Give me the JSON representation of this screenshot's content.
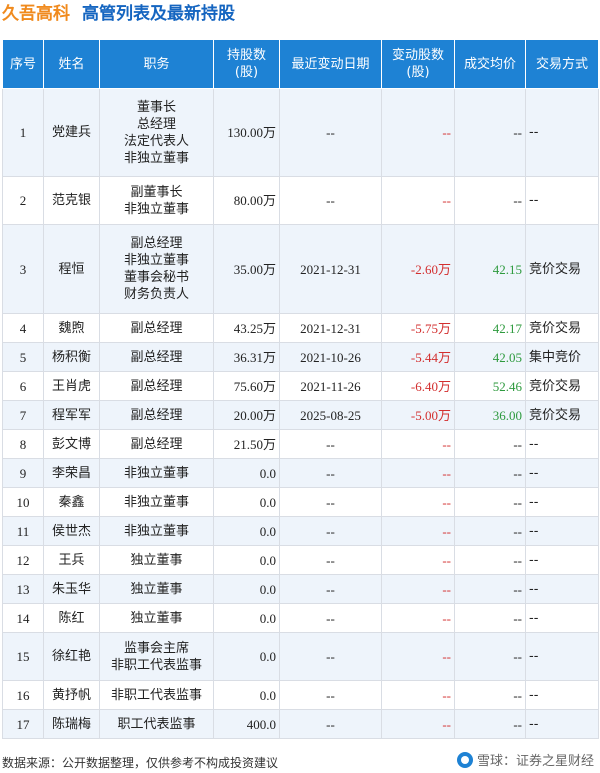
{
  "title": {
    "company": "久吾高科",
    "subtitle": "高管列表及最新持股"
  },
  "table": {
    "headers": [
      "序号",
      "姓名",
      "职务",
      "持股数\n(股)",
      "最近变动日期",
      "变动股数\n(股)",
      "成交均价",
      "交易方式"
    ],
    "rows": [
      {
        "no": "1",
        "name": "党建兵",
        "roles": [
          "董事长",
          "总经理",
          "法定代表人",
          "非独立董事"
        ],
        "shares": "130.00万",
        "date": "--",
        "change": "--",
        "price": "--",
        "method": "--"
      },
      {
        "no": "2",
        "name": "范克银",
        "roles": [
          "副董事长",
          "非独立董事"
        ],
        "shares": "80.00万",
        "date": "--",
        "change": "--",
        "price": "--",
        "method": "--"
      },
      {
        "no": "3",
        "name": "程恒",
        "roles": [
          "副总经理",
          "非独立董事",
          "董事会秘书",
          "财务负责人"
        ],
        "shares": "35.00万",
        "date": "2021-12-31",
        "change": "-2.60万",
        "price": "42.15",
        "method": "竞价交易"
      },
      {
        "no": "4",
        "name": "魏煦",
        "roles": [
          "副总经理"
        ],
        "shares": "43.25万",
        "date": "2021-12-31",
        "change": "-5.75万",
        "price": "42.17",
        "method": "竞价交易"
      },
      {
        "no": "5",
        "name": "杨积衡",
        "roles": [
          "副总经理"
        ],
        "shares": "36.31万",
        "date": "2021-10-26",
        "change": "-5.44万",
        "price": "42.05",
        "method": "集中竞价"
      },
      {
        "no": "6",
        "name": "王肖虎",
        "roles": [
          "副总经理"
        ],
        "shares": "75.60万",
        "date": "2021-11-26",
        "change": "-6.40万",
        "price": "52.46",
        "method": "竞价交易"
      },
      {
        "no": "7",
        "name": "程军军",
        "roles": [
          "副总经理"
        ],
        "shares": "20.00万",
        "date": "2025-08-25",
        "change": "-5.00万",
        "price": "36.00",
        "method": "竞价交易"
      },
      {
        "no": "8",
        "name": "彭文博",
        "roles": [
          "副总经理"
        ],
        "shares": "21.50万",
        "date": "--",
        "change": "--",
        "price": "--",
        "method": "--"
      },
      {
        "no": "9",
        "name": "李荣昌",
        "roles": [
          "非独立董事"
        ],
        "shares": "0.0",
        "date": "--",
        "change": "--",
        "price": "--",
        "method": "--"
      },
      {
        "no": "10",
        "name": "秦鑫",
        "roles": [
          "非独立董事"
        ],
        "shares": "0.0",
        "date": "--",
        "change": "--",
        "price": "--",
        "method": "--"
      },
      {
        "no": "11",
        "name": "侯世杰",
        "roles": [
          "非独立董事"
        ],
        "shares": "0.0",
        "date": "--",
        "change": "--",
        "price": "--",
        "method": "--"
      },
      {
        "no": "12",
        "name": "王兵",
        "roles": [
          "独立董事"
        ],
        "shares": "0.0",
        "date": "--",
        "change": "--",
        "price": "--",
        "method": "--"
      },
      {
        "no": "13",
        "name": "朱玉华",
        "roles": [
          "独立董事"
        ],
        "shares": "0.0",
        "date": "--",
        "change": "--",
        "price": "--",
        "method": "--"
      },
      {
        "no": "14",
        "name": "陈红",
        "roles": [
          "独立董事"
        ],
        "shares": "0.0",
        "date": "--",
        "change": "--",
        "price": "--",
        "method": "--"
      },
      {
        "no": "15",
        "name": "徐红艳",
        "roles": [
          "监事会主席",
          "非职工代表监事"
        ],
        "shares": "0.0",
        "date": "--",
        "change": "--",
        "price": "--",
        "method": "--"
      },
      {
        "no": "16",
        "name": "黄抒帆",
        "roles": [
          "非职工代表监事"
        ],
        "shares": "0.0",
        "date": "--",
        "change": "--",
        "price": "--",
        "method": "--"
      },
      {
        "no": "17",
        "name": "陈瑞梅",
        "roles": [
          "职工代表监事"
        ],
        "shares": "400.0",
        "date": "--",
        "change": "--",
        "price": "--",
        "method": "--"
      }
    ]
  },
  "footer": {
    "source": "数据来源：公开数据整理，仅供参考不构成投资建议",
    "brand": "雪球：证券之星财经"
  },
  "watermark": "证券之星",
  "colors": {
    "header_bg": "#1e82d4",
    "company": "#f08a1d",
    "title": "#1565c0",
    "negative": "#d32f2f",
    "positive": "#2e9a3e",
    "row_alt": "#eef4fb"
  }
}
